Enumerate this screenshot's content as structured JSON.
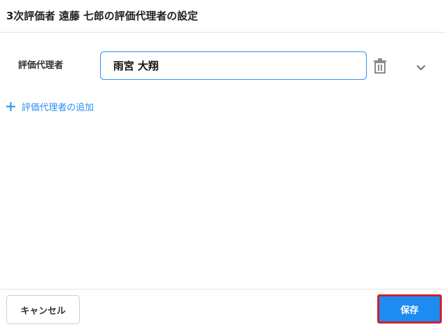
{
  "dialog": {
    "title": "3次評価者 遠藤 七郎の評価代理者の設定"
  },
  "proxy_row": {
    "label": "評価代理者",
    "input_value": "雨宮 大翔",
    "delete_icon": "trash-icon",
    "expand_icon": "chevron-down-icon"
  },
  "add_proxy": {
    "icon": "plus-icon",
    "label": "評価代理者の追加"
  },
  "footer": {
    "cancel_label": "キャンセル",
    "save_label": "保存"
  },
  "colors": {
    "accent": "#1d8cf0",
    "link": "#2b8ef3",
    "highlight_border": "#d0202f"
  }
}
